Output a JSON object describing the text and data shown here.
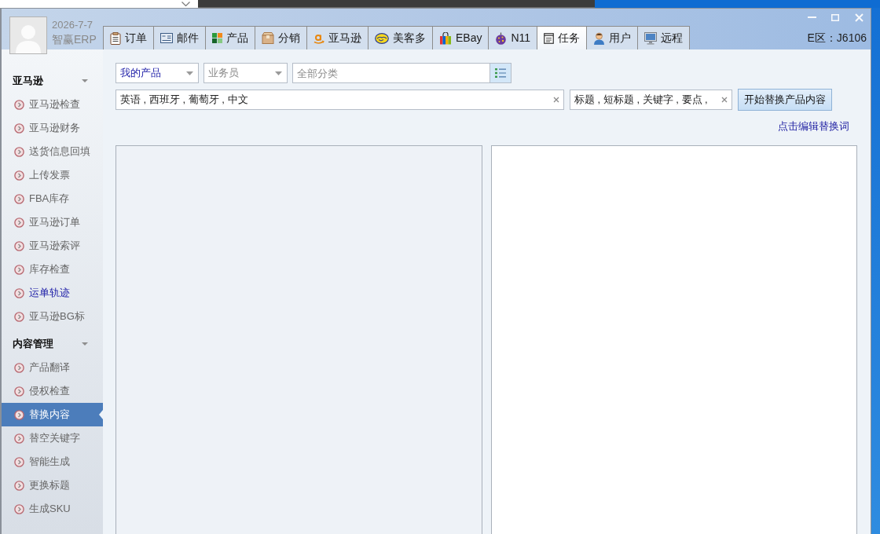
{
  "app": {
    "date": "2026-7-7",
    "name": "智赢ERP"
  },
  "tabs": [
    {
      "label": "订单",
      "selected": false
    },
    {
      "label": "邮件",
      "selected": false
    },
    {
      "label": "产品",
      "selected": false
    },
    {
      "label": "分销",
      "selected": false
    },
    {
      "label": "亚马逊",
      "selected": false
    },
    {
      "label": "美客多",
      "selected": false
    },
    {
      "label": "EBay",
      "selected": false
    },
    {
      "label": "N11",
      "selected": false
    },
    {
      "label": "任务",
      "selected": true
    },
    {
      "label": "用户",
      "selected": false
    },
    {
      "label": "远程",
      "selected": false
    }
  ],
  "region": "E区：J6106",
  "sidebar": {
    "groups": [
      {
        "title": "亚马逊",
        "items": [
          {
            "label": "亚马逊检查",
            "selected": false,
            "visited": false
          },
          {
            "label": "亚马逊财务",
            "selected": false,
            "visited": false
          },
          {
            "label": "送货信息回填",
            "selected": false,
            "visited": false
          },
          {
            "label": "上传发票",
            "selected": false,
            "visited": false
          },
          {
            "label": "FBA库存",
            "selected": false,
            "visited": false
          },
          {
            "label": "亚马逊订单",
            "selected": false,
            "visited": false
          },
          {
            "label": "亚马逊索评",
            "selected": false,
            "visited": false
          },
          {
            "label": "库存检查",
            "selected": false,
            "visited": false
          },
          {
            "label": "运单轨迹",
            "selected": false,
            "visited": true
          },
          {
            "label": "亚马逊BG标",
            "selected": false,
            "visited": false
          }
        ]
      },
      {
        "title": "内容管理",
        "items": [
          {
            "label": "产品翻译",
            "selected": false,
            "visited": false
          },
          {
            "label": "侵权检查",
            "selected": false,
            "visited": false
          },
          {
            "label": "替换内容",
            "selected": true,
            "visited": false
          },
          {
            "label": "替空关键字",
            "selected": false,
            "visited": false
          },
          {
            "label": "智能生成",
            "selected": false,
            "visited": false
          },
          {
            "label": "更换标题",
            "selected": false,
            "visited": false
          },
          {
            "label": "生成SKU",
            "selected": false,
            "visited": false
          }
        ]
      }
    ]
  },
  "filters": {
    "scope": {
      "value": "我的产品"
    },
    "salesperson": {
      "placeholder": "业务员"
    },
    "category": {
      "placeholder": "全部分类"
    }
  },
  "languages": {
    "value": "英语 , 西班牙 , 葡萄牙 , 中文"
  },
  "fields": {
    "value": "标题 , 短标题 , 关键字 , 要点 ,"
  },
  "start_button": {
    "label": "开始替换产品内容"
  },
  "edit_link": {
    "label": "点击编辑替换词"
  }
}
